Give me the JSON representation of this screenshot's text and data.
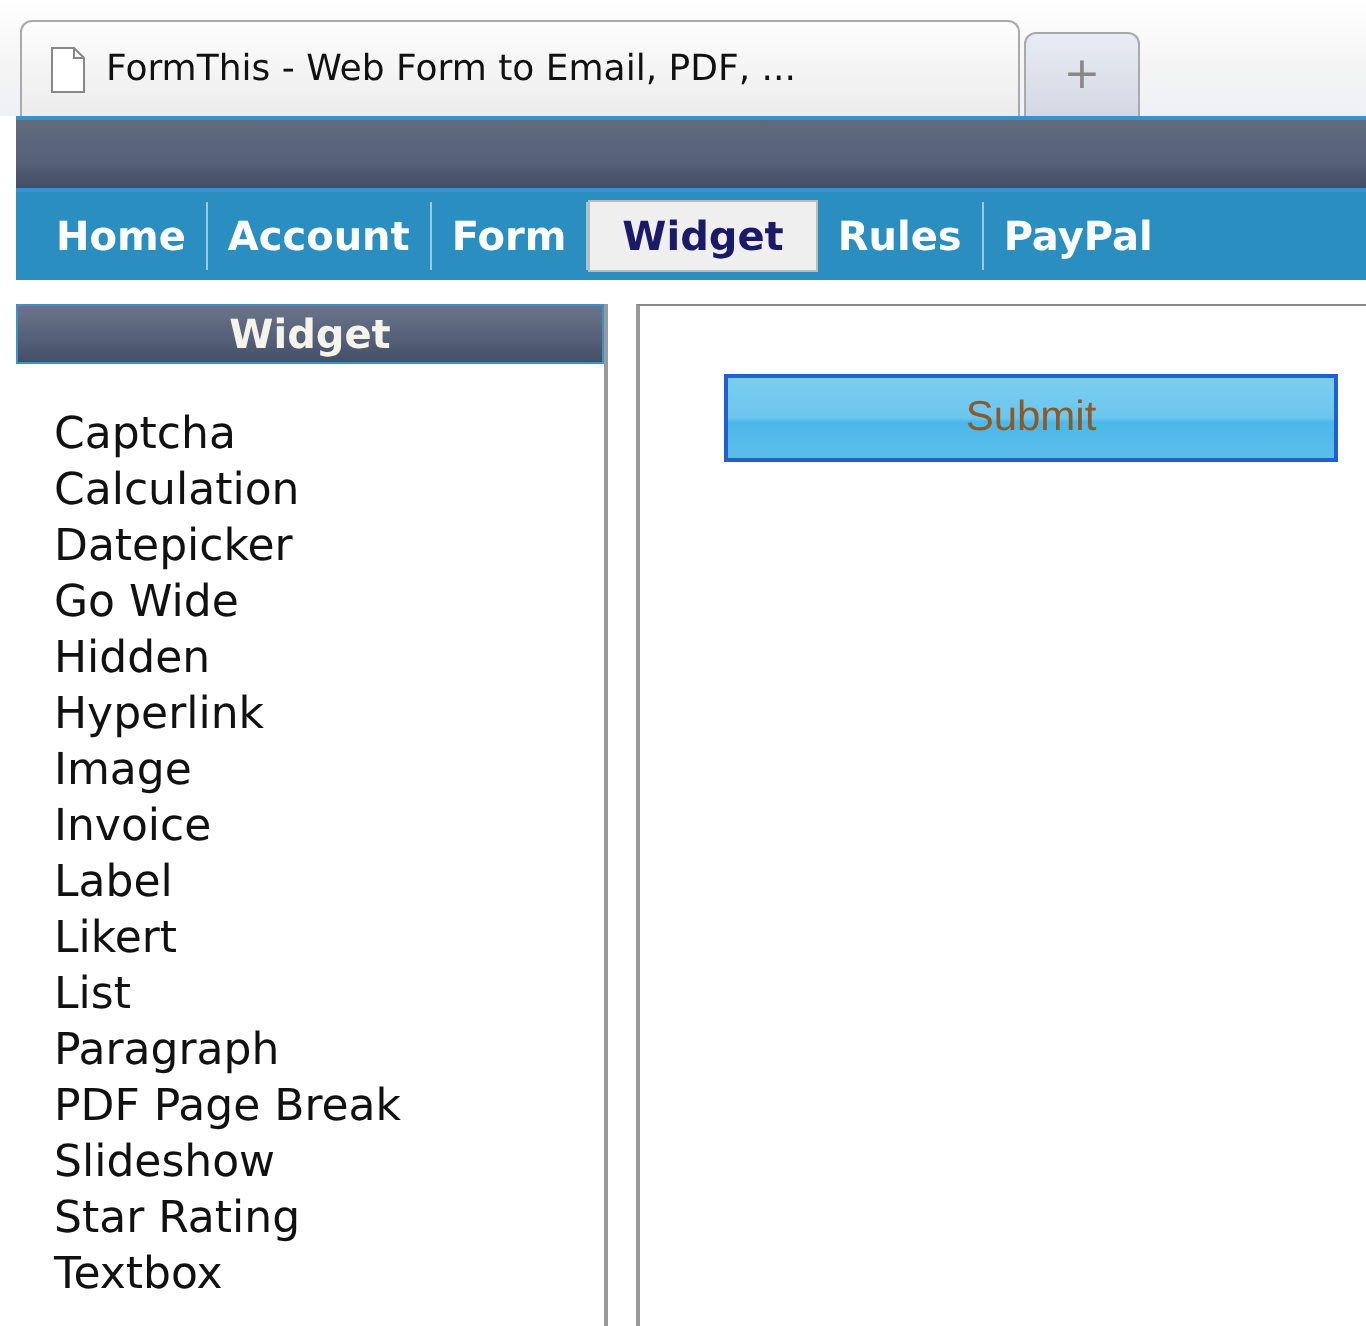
{
  "browser_tabs": [
    {
      "title": "FormThis - Web Form to Email, PDF, ...",
      "kind": "page"
    },
    {
      "title": "+",
      "kind": "new"
    }
  ],
  "nav": [
    {
      "label": "Home",
      "selected": false
    },
    {
      "label": "Account",
      "selected": false
    },
    {
      "label": "Form",
      "selected": false
    },
    {
      "label": "Widget",
      "selected": true
    },
    {
      "label": "Rules",
      "selected": false
    },
    {
      "label": "PayPal",
      "selected": false
    }
  ],
  "sidebar": {
    "title": "Widget",
    "items": [
      "Captcha",
      "Calculation",
      "Datepicker",
      "Go Wide",
      "Hidden",
      "Hyperlink",
      "Image",
      "Invoice",
      "Label",
      "Likert",
      "List",
      "Paragraph",
      "PDF Page Break",
      "Slideshow",
      "Star Rating",
      "Textbox"
    ]
  },
  "form": {
    "submit_label": "Submit"
  }
}
